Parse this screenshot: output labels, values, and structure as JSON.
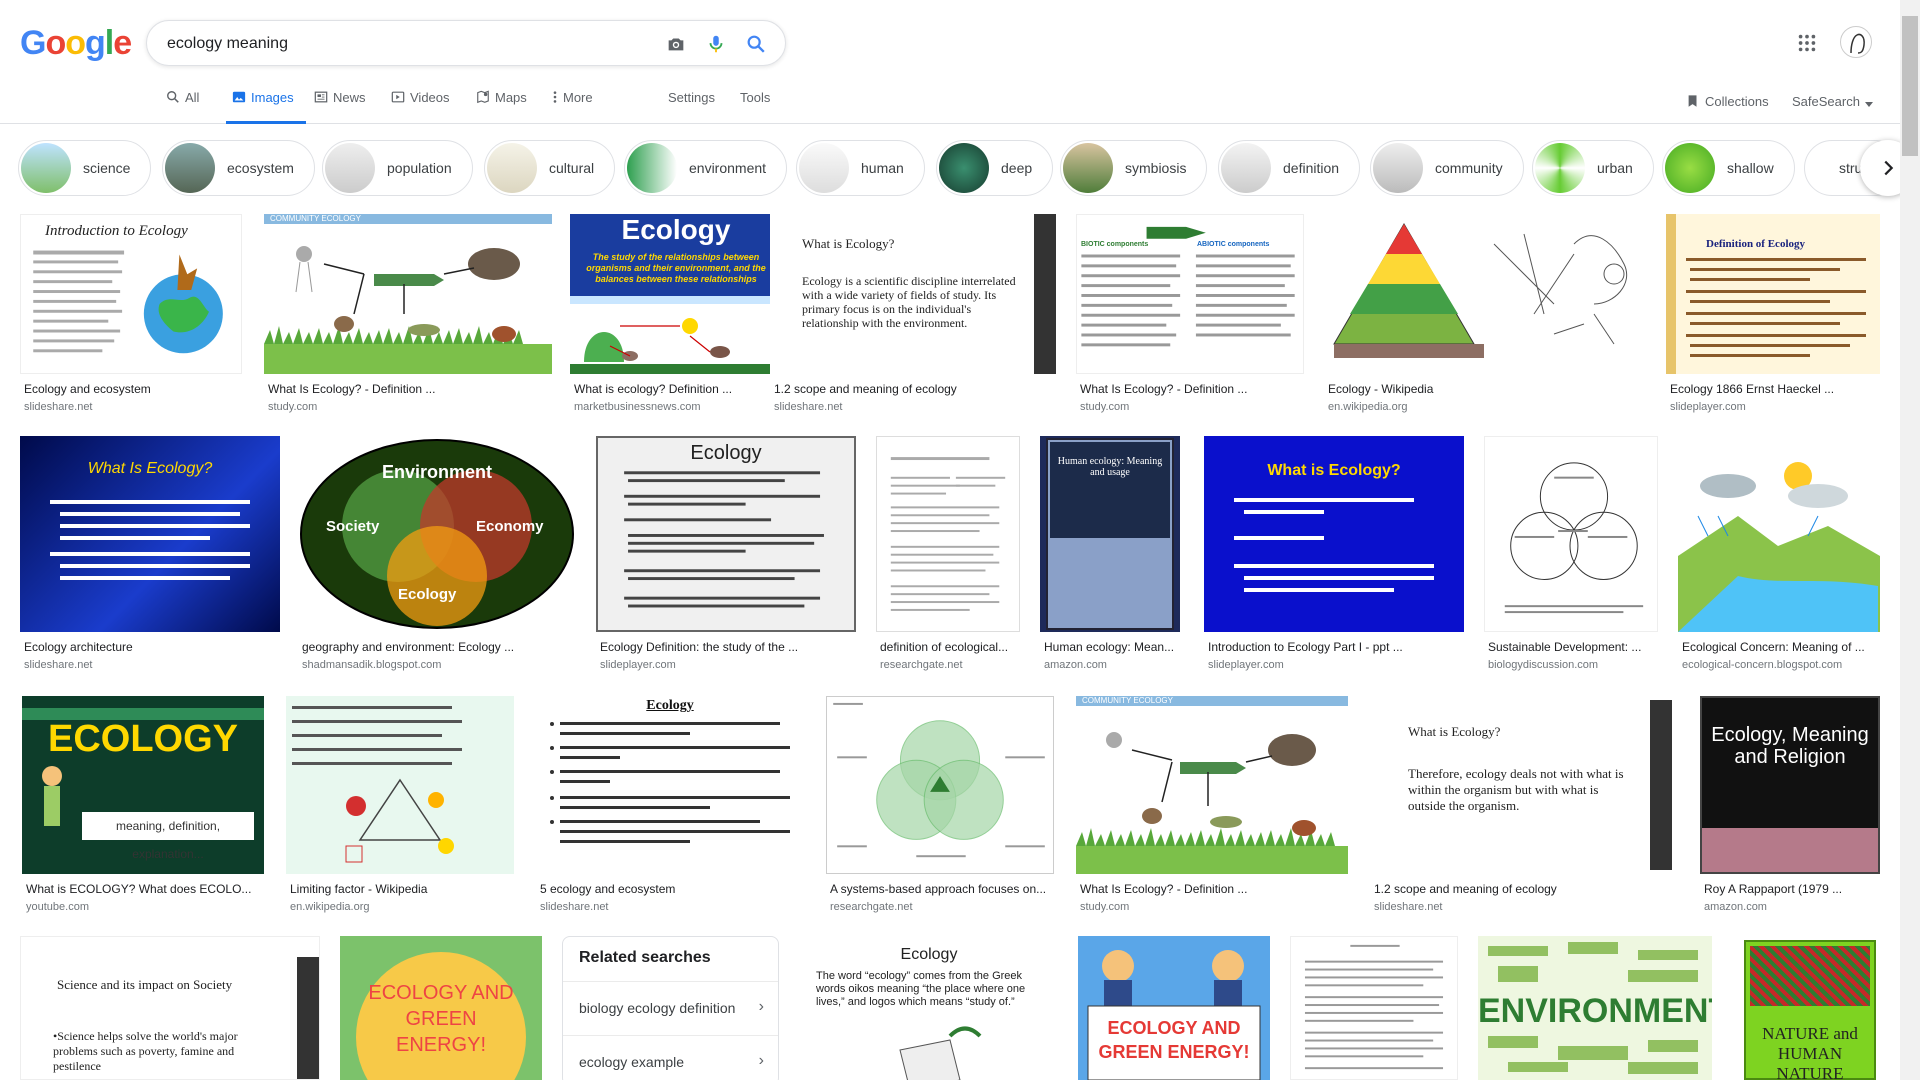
{
  "logo": {
    "letters": [
      "G",
      "o",
      "o",
      "g",
      "l",
      "e"
    ],
    "colors": [
      "#4285f4",
      "#ea4335",
      "#fbbc05",
      "#4285f4",
      "#34a853",
      "#ea4335"
    ]
  },
  "search": {
    "query": "ecology meaning"
  },
  "header": {
    "tabs": [
      {
        "label": "All",
        "icon": "search-icon"
      },
      {
        "label": "Images",
        "icon": "image-icon"
      },
      {
        "label": "News",
        "icon": "news-icon"
      },
      {
        "label": "Videos",
        "icon": "video-icon"
      },
      {
        "label": "Maps",
        "icon": "maps-icon"
      },
      {
        "label": "More",
        "icon": "more-vert-icon"
      },
      {
        "label": "Settings"
      },
      {
        "label": "Tools"
      }
    ],
    "collections": "Collections",
    "safesearch": "SafeSearch"
  },
  "chips": [
    "science",
    "ecosystem",
    "population",
    "cultural",
    "environment",
    "human",
    "deep",
    "symbiosis",
    "definition",
    "community",
    "urban",
    "shallow",
    "structu"
  ],
  "results": [
    {
      "caption": "Ecology and ecosystem",
      "domain": "slideshare.net",
      "thumb_title": "Introduction to Ecology"
    },
    {
      "caption": "What Is Ecology? - Definition ...",
      "domain": "study.com",
      "thumb_title": "COMMUNITY ECOLOGY"
    },
    {
      "caption": "What is ecology? Definition ...",
      "domain": "marketbusinessnews.com",
      "thumb_title": "Ecology",
      "thumb_sub": "The study of the relationships between organisms and their environment, and the balances between these relationships"
    },
    {
      "caption": "1.2 scope and meaning of ecology",
      "domain": "slideshare.net",
      "thumb_title": "What is Ecology?",
      "thumb_sub": "Ecology is a scientific discipline interrelated with a wide variety of fields of study. Its primary focus is on the individual's relationship with the environment."
    },
    {
      "caption": "What Is Ecology? - Definition ...",
      "domain": "study.com",
      "thumb_title": "BIOTIC components",
      "thumb_sub": "ABIOTIC components"
    },
    {
      "caption": "Ecology - Wikipedia",
      "domain": "en.wikipedia.org"
    },
    {
      "caption": "Ecology 1866 Ernst Haeckel ...",
      "domain": "slideplayer.com",
      "thumb_title": "Definition of Ecology"
    },
    {
      "caption": "Ecology architecture",
      "domain": "slideshare.net",
      "thumb_title": "What Is Ecology?"
    },
    {
      "caption": "geography and environment: Ecology ...",
      "domain": "shadmansadik.blogspot.com",
      "thumb_title": "Environment",
      "thumb_sub": "Society",
      "thumb_sub2": "Economy",
      "thumb_sub3": "Ecology"
    },
    {
      "caption": "Ecology Definition: the study of the ...",
      "domain": "slideplayer.com",
      "thumb_title": "Ecology"
    },
    {
      "caption": "definition of ecological...",
      "domain": "researchgate.net"
    },
    {
      "caption": "Human ecology: Mean...",
      "domain": "amazon.com",
      "thumb_title": "Human ecology: Meaning and usage"
    },
    {
      "caption": "Introduction to Ecology Part I - ppt ...",
      "domain": "slideplayer.com",
      "thumb_title": "What is Ecology?"
    },
    {
      "caption": "Sustainable Development: ...",
      "domain": "biologydiscussion.com"
    },
    {
      "caption": "Ecological Concern: Meaning of ...",
      "domain": "ecological-concern.blogspot.com"
    },
    {
      "caption": "What is ECOLOGY? What does ECOLO...",
      "domain": "youtube.com",
      "thumb_title": "ECOLOGY",
      "thumb_sub": "meaning, definition, explanation..."
    },
    {
      "caption": "Limiting factor - Wikipedia",
      "domain": "en.wikipedia.org"
    },
    {
      "caption": "5 ecology and ecosystem",
      "domain": "slideshare.net",
      "thumb_title": "Ecology"
    },
    {
      "caption": "A systems-based approach focuses on...",
      "domain": "researchgate.net"
    },
    {
      "caption": "What Is Ecology? - Definition ...",
      "domain": "study.com",
      "thumb_title": "COMMUNITY ECOLOGY"
    },
    {
      "caption": "1.2 scope and meaning of ecology",
      "domain": "slideshare.net",
      "thumb_title": "What is Ecology?",
      "thumb_sub": "Therefore, ecology deals not with what is within the organism but with what is outside the organism."
    },
    {
      "caption": "Roy A Rappaport (1979 ...",
      "domain": "amazon.com",
      "thumb_title": "Ecology, Meaning and Religion"
    },
    {
      "thumb_title": "Science and its impact on Society",
      "thumb_sub": "•Science helps solve the world's major problems such as poverty, famine and pestilence"
    },
    {
      "thumb_title": "ECOLOGY AND GREEN ENERGY!"
    },
    {
      "thumb_title": "Ecology",
      "thumb_sub": "The word “ecology” comes from the Greek words oikos meaning “the place where one lives,” and logos which means “study of.”"
    },
    {
      "thumb_title": "ECOLOGY AND GREEN ENERGY!"
    },
    {},
    {
      "thumb_title": "ENVIRONMENTAL"
    },
    {
      "thumb_title": "NATURE and HUMAN NATURE"
    }
  ],
  "related": {
    "title": "Related searches",
    "items": [
      "biology ecology definition",
      "ecology example"
    ]
  }
}
